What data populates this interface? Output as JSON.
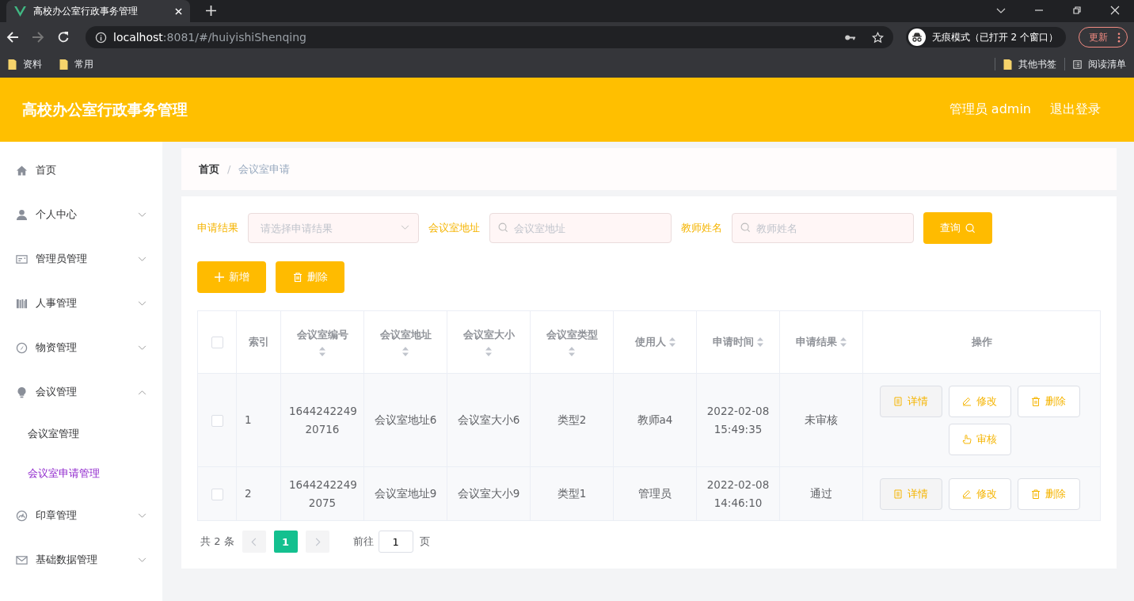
{
  "browser": {
    "tab_title": "高校办公室行政事务管理",
    "url_host": "localhost",
    "url_path": ":8081/#/huiyishiShenqing",
    "incognito": "无痕模式（已打开 2 个窗口）",
    "update": "更新",
    "bookmarks": [
      "资料",
      "常用"
    ],
    "other_bookmarks": "其他书签",
    "reading_list": "阅读清单"
  },
  "header": {
    "title": "高校办公室行政事务管理",
    "user": "管理员 admin",
    "logout": "退出登录"
  },
  "sidebar": {
    "items": [
      {
        "label": "首页",
        "kind": "home"
      },
      {
        "label": "个人中心",
        "kind": "user",
        "expanded": false
      },
      {
        "label": "管理员管理",
        "kind": "card",
        "expanded": false
      },
      {
        "label": "人事管理",
        "kind": "books",
        "expanded": false
      },
      {
        "label": "物资管理",
        "kind": "compass",
        "expanded": false
      },
      {
        "label": "会议管理",
        "kind": "bulb",
        "expanded": true,
        "children": [
          {
            "label": "会议室管理",
            "selected": false
          },
          {
            "label": "会议室申请管理",
            "selected": true
          }
        ]
      },
      {
        "label": "印章管理",
        "kind": "gauge",
        "expanded": false
      },
      {
        "label": "基础数据管理",
        "kind": "mail",
        "expanded": false
      }
    ]
  },
  "breadcrumb": {
    "items": [
      "首页",
      "会议室申请"
    ],
    "separator": "/"
  },
  "filters": [
    {
      "label": "申请结果",
      "kind": "select",
      "placeholder": "请选择申请结果"
    },
    {
      "label": "会议室地址",
      "kind": "search",
      "placeholder": "会议室地址"
    },
    {
      "label": "教师姓名",
      "kind": "search",
      "placeholder": "教师姓名"
    }
  ],
  "query_button": "查询",
  "toolbar": [
    {
      "label": "新增",
      "kind": "add"
    },
    {
      "label": "删除",
      "kind": "delete"
    }
  ],
  "table": {
    "select_all": false,
    "columns": [
      {
        "label": "索引",
        "sortable": false
      },
      {
        "label": "会议室编号",
        "sortable": true
      },
      {
        "label": "会议室地址",
        "sortable": true
      },
      {
        "label": "会议室大小",
        "sortable": true
      },
      {
        "label": "会议室类型",
        "sortable": true
      },
      {
        "label": "使用人",
        "sortable": true
      },
      {
        "label": "申请时间",
        "sortable": true
      },
      {
        "label": "申请结果",
        "sortable": true
      },
      {
        "label": "操作",
        "sortable": false
      }
    ],
    "rows": [
      {
        "checked": false,
        "cells": [
          "1",
          "1644242249 20716",
          "会议室地址6",
          "会议室大小6",
          "类型2",
          "教师a4",
          "2022-02-08 15:49:35",
          "未审核"
        ],
        "actions": [
          {
            "label": "详情",
            "kind": "detail"
          },
          {
            "label": "修改",
            "kind": "edit"
          },
          {
            "label": "删除",
            "kind": "delete"
          },
          {
            "label": "审核",
            "kind": "review"
          }
        ]
      },
      {
        "checked": false,
        "cells": [
          "2",
          "1644242249 2075",
          "会议室地址9",
          "会议室大小9",
          "类型1",
          "管理员",
          "2022-02-08 14:46:10",
          "通过"
        ],
        "actions": [
          {
            "label": "详情",
            "kind": "detail"
          },
          {
            "label": "修改",
            "kind": "edit"
          },
          {
            "label": "删除",
            "kind": "delete"
          }
        ]
      }
    ]
  },
  "pagination": {
    "total": "共 2 条",
    "pages": [
      {
        "label": "1",
        "selected": true
      }
    ],
    "goto": "前往",
    "goto_value": "1",
    "suffix": "页"
  }
}
